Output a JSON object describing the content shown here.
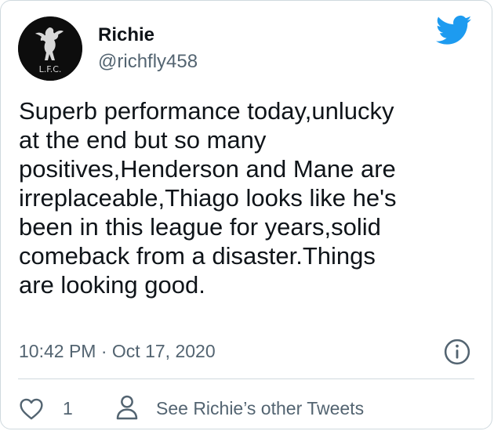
{
  "author": {
    "name": "Richie",
    "handle": "@richfly458",
    "avatar_text": "L.F.C."
  },
  "tweet": {
    "text": "Superb performance today,unlucky\nat the end but so many\npositives,Henderson and Mane are\nirreplaceable,Thiago looks like he's\nbeen in this league for years,solid\ncomeback from a disaster.Things\nare looking good.",
    "time": "10:42 PM",
    "separator": "·",
    "date": "Oct 17, 2020"
  },
  "actions": {
    "like_count": "1",
    "other_tweets_label": "See Richie’s other Tweets"
  },
  "icons": {
    "brand": "twitter-bird-icon",
    "info": "info-icon",
    "like": "heart-icon",
    "profile": "person-icon"
  },
  "colors": {
    "brand_blue": "#1d9bf0",
    "text_primary": "#0f1419",
    "text_secondary": "#536471",
    "border": "#cfd9de"
  }
}
